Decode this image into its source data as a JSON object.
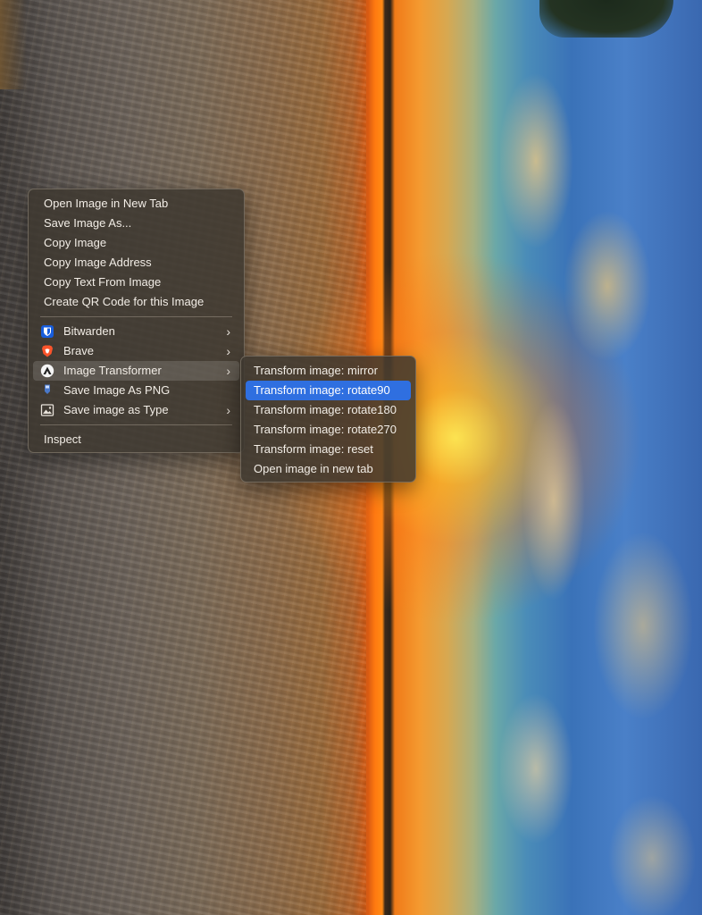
{
  "context_menu": {
    "group1": [
      "Open Image in New Tab",
      "Save Image As...",
      "Copy Image",
      "Copy Image Address",
      "Copy Text From Image",
      "Create QR Code for this Image"
    ],
    "extensions": [
      {
        "label": "Bitwarden",
        "icon": "bitwarden-shield-icon",
        "has_submenu": true
      },
      {
        "label": "Brave",
        "icon": "brave-lion-icon",
        "has_submenu": true
      },
      {
        "label": "Image Transformer",
        "icon": "image-transformer-icon",
        "has_submenu": true,
        "state": "open"
      },
      {
        "label": "Save Image As PNG",
        "icon": "save-png-icon",
        "has_submenu": false
      },
      {
        "label": "Save image as Type",
        "icon": "picture-icon",
        "has_submenu": true
      }
    ],
    "inspect": "Inspect"
  },
  "submenu": {
    "items": [
      "Transform image: mirror",
      "Transform image: rotate90",
      "Transform image: rotate180",
      "Transform image: rotate270",
      "Transform image: reset",
      "Open image in new tab"
    ],
    "selected_index": 1
  },
  "colors": {
    "selection": "#2f6fe0",
    "menu_bg": "#3e3830"
  }
}
